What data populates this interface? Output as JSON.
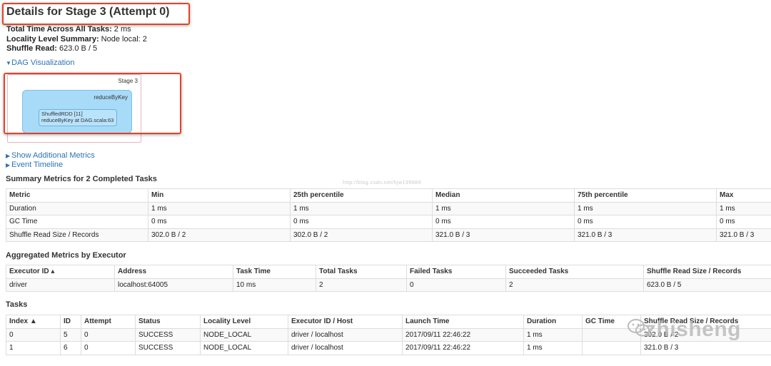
{
  "header": {
    "title": "Details for Stage 3 (Attempt 0)",
    "summary": [
      {
        "label": "Total Time Across All Tasks:",
        "value": "2 ms"
      },
      {
        "label": "Locality Level Summary:",
        "value": "Node local: 2"
      },
      {
        "label": "Shuffle Read:",
        "value": "623.0 B / 5"
      }
    ]
  },
  "dag": {
    "toggle_label": "DAG Visualization",
    "stage_label": "Stage 3",
    "cluster_label": "reduceByKey",
    "node_line1": "ShuffledRDD [11]",
    "node_line2": "reduceByKey at DAG.scala:63"
  },
  "links": {
    "additional_metrics": "Show Additional Metrics",
    "event_timeline": "Event Timeline"
  },
  "summary_metrics": {
    "title": "Summary Metrics for 2 Completed Tasks",
    "headers": [
      "Metric",
      "Min",
      "25th percentile",
      "Median",
      "75th percentile",
      "Max"
    ],
    "rows": [
      [
        "Duration",
        "1 ms",
        "1 ms",
        "1 ms",
        "1 ms",
        "1 ms"
      ],
      [
        "GC Time",
        "0 ms",
        "0 ms",
        "0 ms",
        "0 ms",
        "0 ms"
      ],
      [
        "Shuffle Read Size / Records",
        "302.0 B / 2",
        "302.0 B / 2",
        "321.0 B / 3",
        "321.0 B / 3",
        "321.0 B / 3"
      ]
    ]
  },
  "aggregated": {
    "title": "Aggregated Metrics by Executor",
    "headers": [
      "Executor ID ▴",
      "Address",
      "Task Time",
      "Total Tasks",
      "Failed Tasks",
      "Succeeded Tasks",
      "Shuffle Read Size / Records"
    ],
    "rows": [
      [
        "driver",
        "localhost:64005",
        "10 ms",
        "2",
        "0",
        "2",
        "623.0 B / 5"
      ]
    ]
  },
  "tasks": {
    "title": "Tasks",
    "headers": [
      "Index ▲",
      "ID",
      "Attempt",
      "Status",
      "Locality Level",
      "Executor ID / Host",
      "Launch Time",
      "Duration",
      "GC Time",
      "Shuffle Read Size / Records"
    ],
    "rows": [
      [
        "0",
        "5",
        "0",
        "SUCCESS",
        "NODE_LOCAL",
        "driver / localhost",
        "2017/09/11 22:46:22",
        "1 ms",
        "",
        "302.0 B / 2"
      ],
      [
        "1",
        "6",
        "0",
        "SUCCESS",
        "NODE_LOCAL",
        "driver / localhost",
        "2017/09/11 22:46:22",
        "1 ms",
        "",
        "321.0 B / 3"
      ]
    ]
  },
  "watermarks": {
    "url": "http://blog.csdn.net/hjw199089",
    "brand": "zhisheng"
  },
  "colors": {
    "link": "#2d73b4",
    "highlight": "#e0432a",
    "dag_cluster": "#a8dbf8"
  }
}
